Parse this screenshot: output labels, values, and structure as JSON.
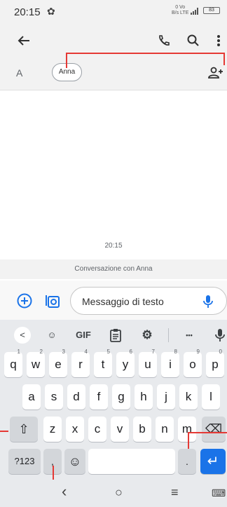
{
  "status_bar": {
    "time": "20:15",
    "network_top": "0  Vo",
    "network_bottom": "B/s LTE",
    "battery": "83"
  },
  "app_bar": {
    "back_icon": "arrow-left-icon",
    "call_icon": "phone-icon",
    "search_icon": "search-icon",
    "more_icon": "more-vert-icon"
  },
  "recipients": {
    "label": "A",
    "chip": "Anna",
    "add_icon": "add-person-icon"
  },
  "conversation": {
    "timestamp": "20:15",
    "banner": "Conversazione con Anna"
  },
  "compose": {
    "add_icon": "plus-circle-icon",
    "media_icon": "camera-gallery-icon",
    "placeholder": "Messaggio di testo",
    "mic_icon": "mic-icon"
  },
  "keyboard": {
    "toolbar": {
      "back": "<",
      "sticker": "☺",
      "gif": "GIF",
      "clipboard": "📋",
      "settings": "⚙",
      "more": "•••",
      "mic": "🎤"
    },
    "row1": [
      {
        "k": "q",
        "h": "1"
      },
      {
        "k": "w",
        "h": "2"
      },
      {
        "k": "e",
        "h": "3"
      },
      {
        "k": "r",
        "h": "4"
      },
      {
        "k": "t",
        "h": "5"
      },
      {
        "k": "y",
        "h": "6"
      },
      {
        "k": "u",
        "h": "7"
      },
      {
        "k": "i",
        "h": "8"
      },
      {
        "k": "o",
        "h": "9"
      },
      {
        "k": "p",
        "h": "0"
      }
    ],
    "row2": [
      "a",
      "s",
      "d",
      "f",
      "g",
      "h",
      "j",
      "k",
      "l"
    ],
    "row3": [
      "z",
      "x",
      "c",
      "v",
      "b",
      "n",
      "m"
    ],
    "shift": "⇧",
    "backspace": "⌫",
    "symbols": "?123",
    "comma": ",",
    "emoji": "☺",
    "period": ".",
    "enter": "↵"
  },
  "nav_bar": {
    "back": "‹",
    "home": "○",
    "recents": "≡",
    "keyboard": "⌨"
  },
  "colors": {
    "accent": "#1a73e8",
    "callout": "#e53935",
    "background": "#f2f2f2"
  }
}
